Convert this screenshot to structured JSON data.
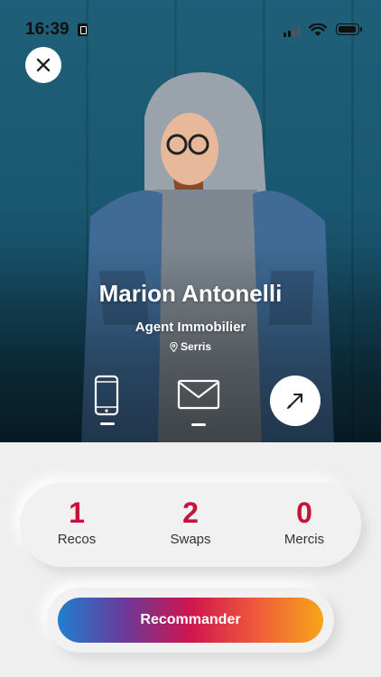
{
  "status_bar": {
    "time": "16:39"
  },
  "profile": {
    "name": "Marion Antonelli",
    "job_title": "Agent Immobilier",
    "location": "Serris"
  },
  "contact_actions": [
    "phone-icon",
    "mail-icon",
    "share-arrow-icon"
  ],
  "stats": [
    {
      "value": "1",
      "label": "Recos"
    },
    {
      "value": "2",
      "label": "Swaps"
    },
    {
      "value": "0",
      "label": "Mercis"
    }
  ],
  "cta": {
    "label": "Recommander"
  },
  "colors": {
    "accent": "#c8123e",
    "gradient_start": "#1f7fcf",
    "gradient_mid": "#d0154f",
    "gradient_end": "#f7a617"
  }
}
